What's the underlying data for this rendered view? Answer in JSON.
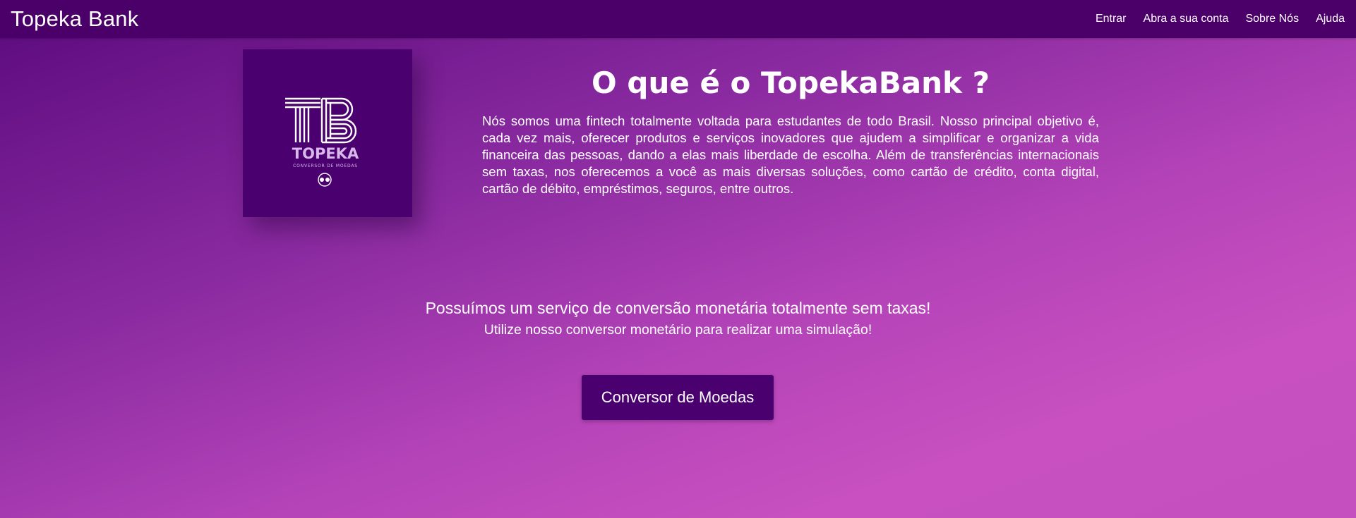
{
  "navbar": {
    "brand": "Topeka Bank",
    "links": [
      "Entrar",
      "Abra a sua conta",
      "Sobre Nós",
      "Ajuda"
    ]
  },
  "logo": {
    "monogram": "TB",
    "name": "TOPEKA",
    "tagline": "CONVERSOR DE MOEDAS"
  },
  "about": {
    "title": "O que é o TopekaBank ?",
    "text": "Nós somos uma fintech totalmente voltada para estudantes de todo Brasil. Nosso principal objetivo é, cada vez mais, oferecer produtos e serviços inovadores que ajudem a simplificar e organizar a vida financeira das pessoas, dando a elas mais liberdade de escolha. Além de transferências internacionais sem taxas, nos oferecemos a você as mais diversas soluções, como cartão de crédito, conta digital, cartão de débito, empréstimos, seguros, entre outros."
  },
  "promo": {
    "heading": "Possuímos um serviço de conversão monetária totalmente sem taxas!",
    "subheading": "Utilize nosso conversor monetário para realizar uma simulação!",
    "button_label": "Conversor de Moedas"
  },
  "colors": {
    "navbar": "#4a0068",
    "logo_bg": "#4b0070",
    "button": "#4b0070",
    "gradient_start": "#5b0a7e",
    "gradient_end": "#c850c0"
  }
}
